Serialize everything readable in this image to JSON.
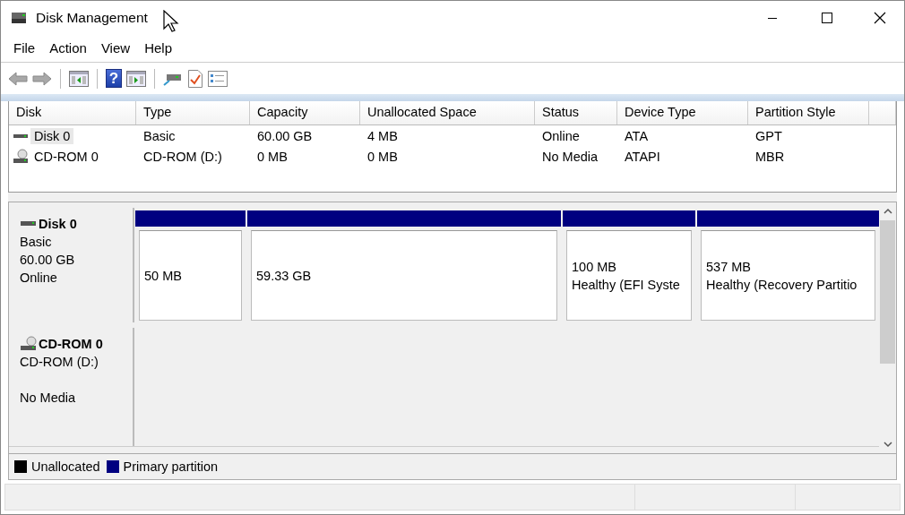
{
  "window": {
    "title": "Disk Management"
  },
  "menu": [
    "File",
    "Action",
    "View",
    "Help"
  ],
  "toolbar": [
    {
      "kind": "back",
      "disabled": true
    },
    {
      "kind": "forward",
      "disabled": true
    },
    {
      "kind": "sep"
    },
    {
      "kind": "pane-left"
    },
    {
      "kind": "sep"
    },
    {
      "kind": "help",
      "glyph": "?"
    },
    {
      "kind": "pane-right"
    },
    {
      "kind": "sep"
    },
    {
      "kind": "drive"
    },
    {
      "kind": "check"
    },
    {
      "kind": "list"
    }
  ],
  "table": {
    "columns": [
      "Disk",
      "Type",
      "Capacity",
      "Unallocated Space",
      "Status",
      "Device Type",
      "Partition Style"
    ],
    "rows": [
      {
        "kind": "disk",
        "selected": true,
        "cells": [
          "Disk 0",
          "Basic",
          "60.00 GB",
          "4 MB",
          "Online",
          "ATA",
          "GPT"
        ]
      },
      {
        "kind": "cdrom",
        "selected": false,
        "cells": [
          "CD-ROM 0",
          "CD-ROM (D:)",
          "0 MB",
          "0 MB",
          "No Media",
          "ATAPI",
          "MBR"
        ]
      }
    ]
  },
  "disks": [
    {
      "kind": "disk",
      "name": "Disk 0",
      "lines": [
        "Basic",
        "60.00 GB",
        "Online"
      ],
      "partitions": [
        {
          "lines": [
            "50 MB"
          ]
        },
        {
          "lines": [
            "59.33 GB"
          ]
        },
        {
          "lines": [
            "100 MB",
            "Healthy (EFI Syste"
          ]
        },
        {
          "lines": [
            "537 MB",
            "Healthy (Recovery Partitio"
          ]
        }
      ]
    },
    {
      "kind": "cdrom",
      "name": "CD-ROM 0",
      "lines": [
        "CD-ROM (D:)",
        "No Media"
      ]
    }
  ],
  "legend": [
    {
      "label": "Unallocated",
      "color": "#000000"
    },
    {
      "label": "Primary partition",
      "color": "#000080"
    }
  ]
}
